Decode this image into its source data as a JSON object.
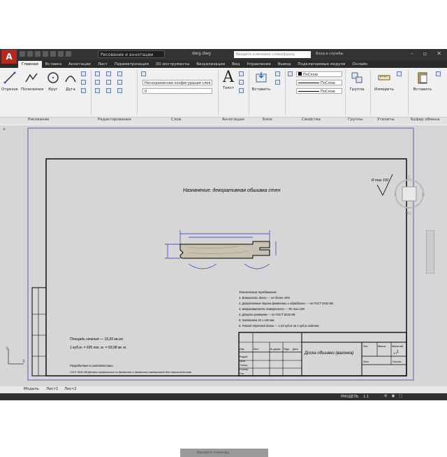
{
  "app": {
    "logo_letter": "A",
    "workspace": "Рисование и аннотации",
    "doc_title": "dwg.dwg",
    "search_placeholder": "Введите ключевое слово/фразу",
    "sign_in": "Вход в службы"
  },
  "tabs": [
    "Главная",
    "Вставка",
    "Аннотации",
    "Лист",
    "Параметризация",
    "3D инструменты",
    "Визуализация",
    "Вид",
    "Управление",
    "Вывод",
    "Подключаемые модули",
    "Онлайн"
  ],
  "ribbon": {
    "draw_tools": [
      "Отрезок",
      "Полилиния",
      "Круг",
      "Дуга"
    ],
    "layer_state": "Несохраненная конфигурация слоя",
    "layer_current": "0",
    "text_label": "Текст",
    "insert_label": "Вставить",
    "bylayer": "ПоСлою",
    "bylayer2": "ПоСлою",
    "bylayer3": "ПоСлою",
    "group_label": "Группа",
    "measure_label": "Измерить",
    "paste_label": "Вставить",
    "groups": [
      "Рисование",
      "Редактирование",
      "Слои",
      "Аннотации",
      "Блок",
      "Свойства",
      "Группы",
      "Утилиты",
      "Буфер обмена"
    ]
  },
  "drawing": {
    "purpose": "Назначение: декоративная обшивка стен",
    "roughness": "R max 100",
    "notes_title": "Технические требования:",
    "notes": [
      "1. Влажность доски — не более 15%",
      "2. Допускаемые пороки древесины и обработки — по ГОСТ 8242-88.",
      "3. Шероховатость поверхности — Rz max 100.",
      "4. Допуски размеров — по ГОСТ 8242-88.",
      "5. Заготовка 22 х 100 мм.",
      "6. Расход обрезной доски — 1,03 куб.м на 1 куб.м изделия."
    ],
    "area_line1": "Площадь сечения — 15,29 кв.см.",
    "area_line2": "1 куб.м. = 695 пог. м. = 59,08 кв. м.",
    "std_title": "Разработано в соответствии",
    "std_line": "ГОСТ 8242-88 Детали профильные из древесины и древесных материалов для строительства",
    "stamp_title": "Доска обшивки (вагонка)",
    "sheet": "Лист",
    "sheets": "Листов",
    "sheet_no": "1",
    "roles": [
      "Разраб.",
      "Пров.",
      "Т.контр.",
      "Н.контр.",
      "Утв."
    ],
    "head_cells": [
      "Изм.",
      "Лист",
      "№ докум.",
      "Подп.",
      "Дата"
    ],
    "lit": "Лит.",
    "mass": "Масса",
    "scale": "Масштаб",
    "scale_val": "1:1"
  },
  "cmdline_placeholder": "Введите команду",
  "layout_tabs": [
    "Модель",
    "Лист1",
    "Лист2"
  ],
  "status": {
    "model": "РМОДЕЛЬ",
    "scale": "1:1"
  },
  "colors": {
    "accent_red": "#b8261c",
    "ribbon_bg": "#f0f0f0",
    "canvas_bg": "#d6d6d6",
    "dimension_blue": "#2233cc",
    "viewport_border": "#5a5ab8"
  }
}
